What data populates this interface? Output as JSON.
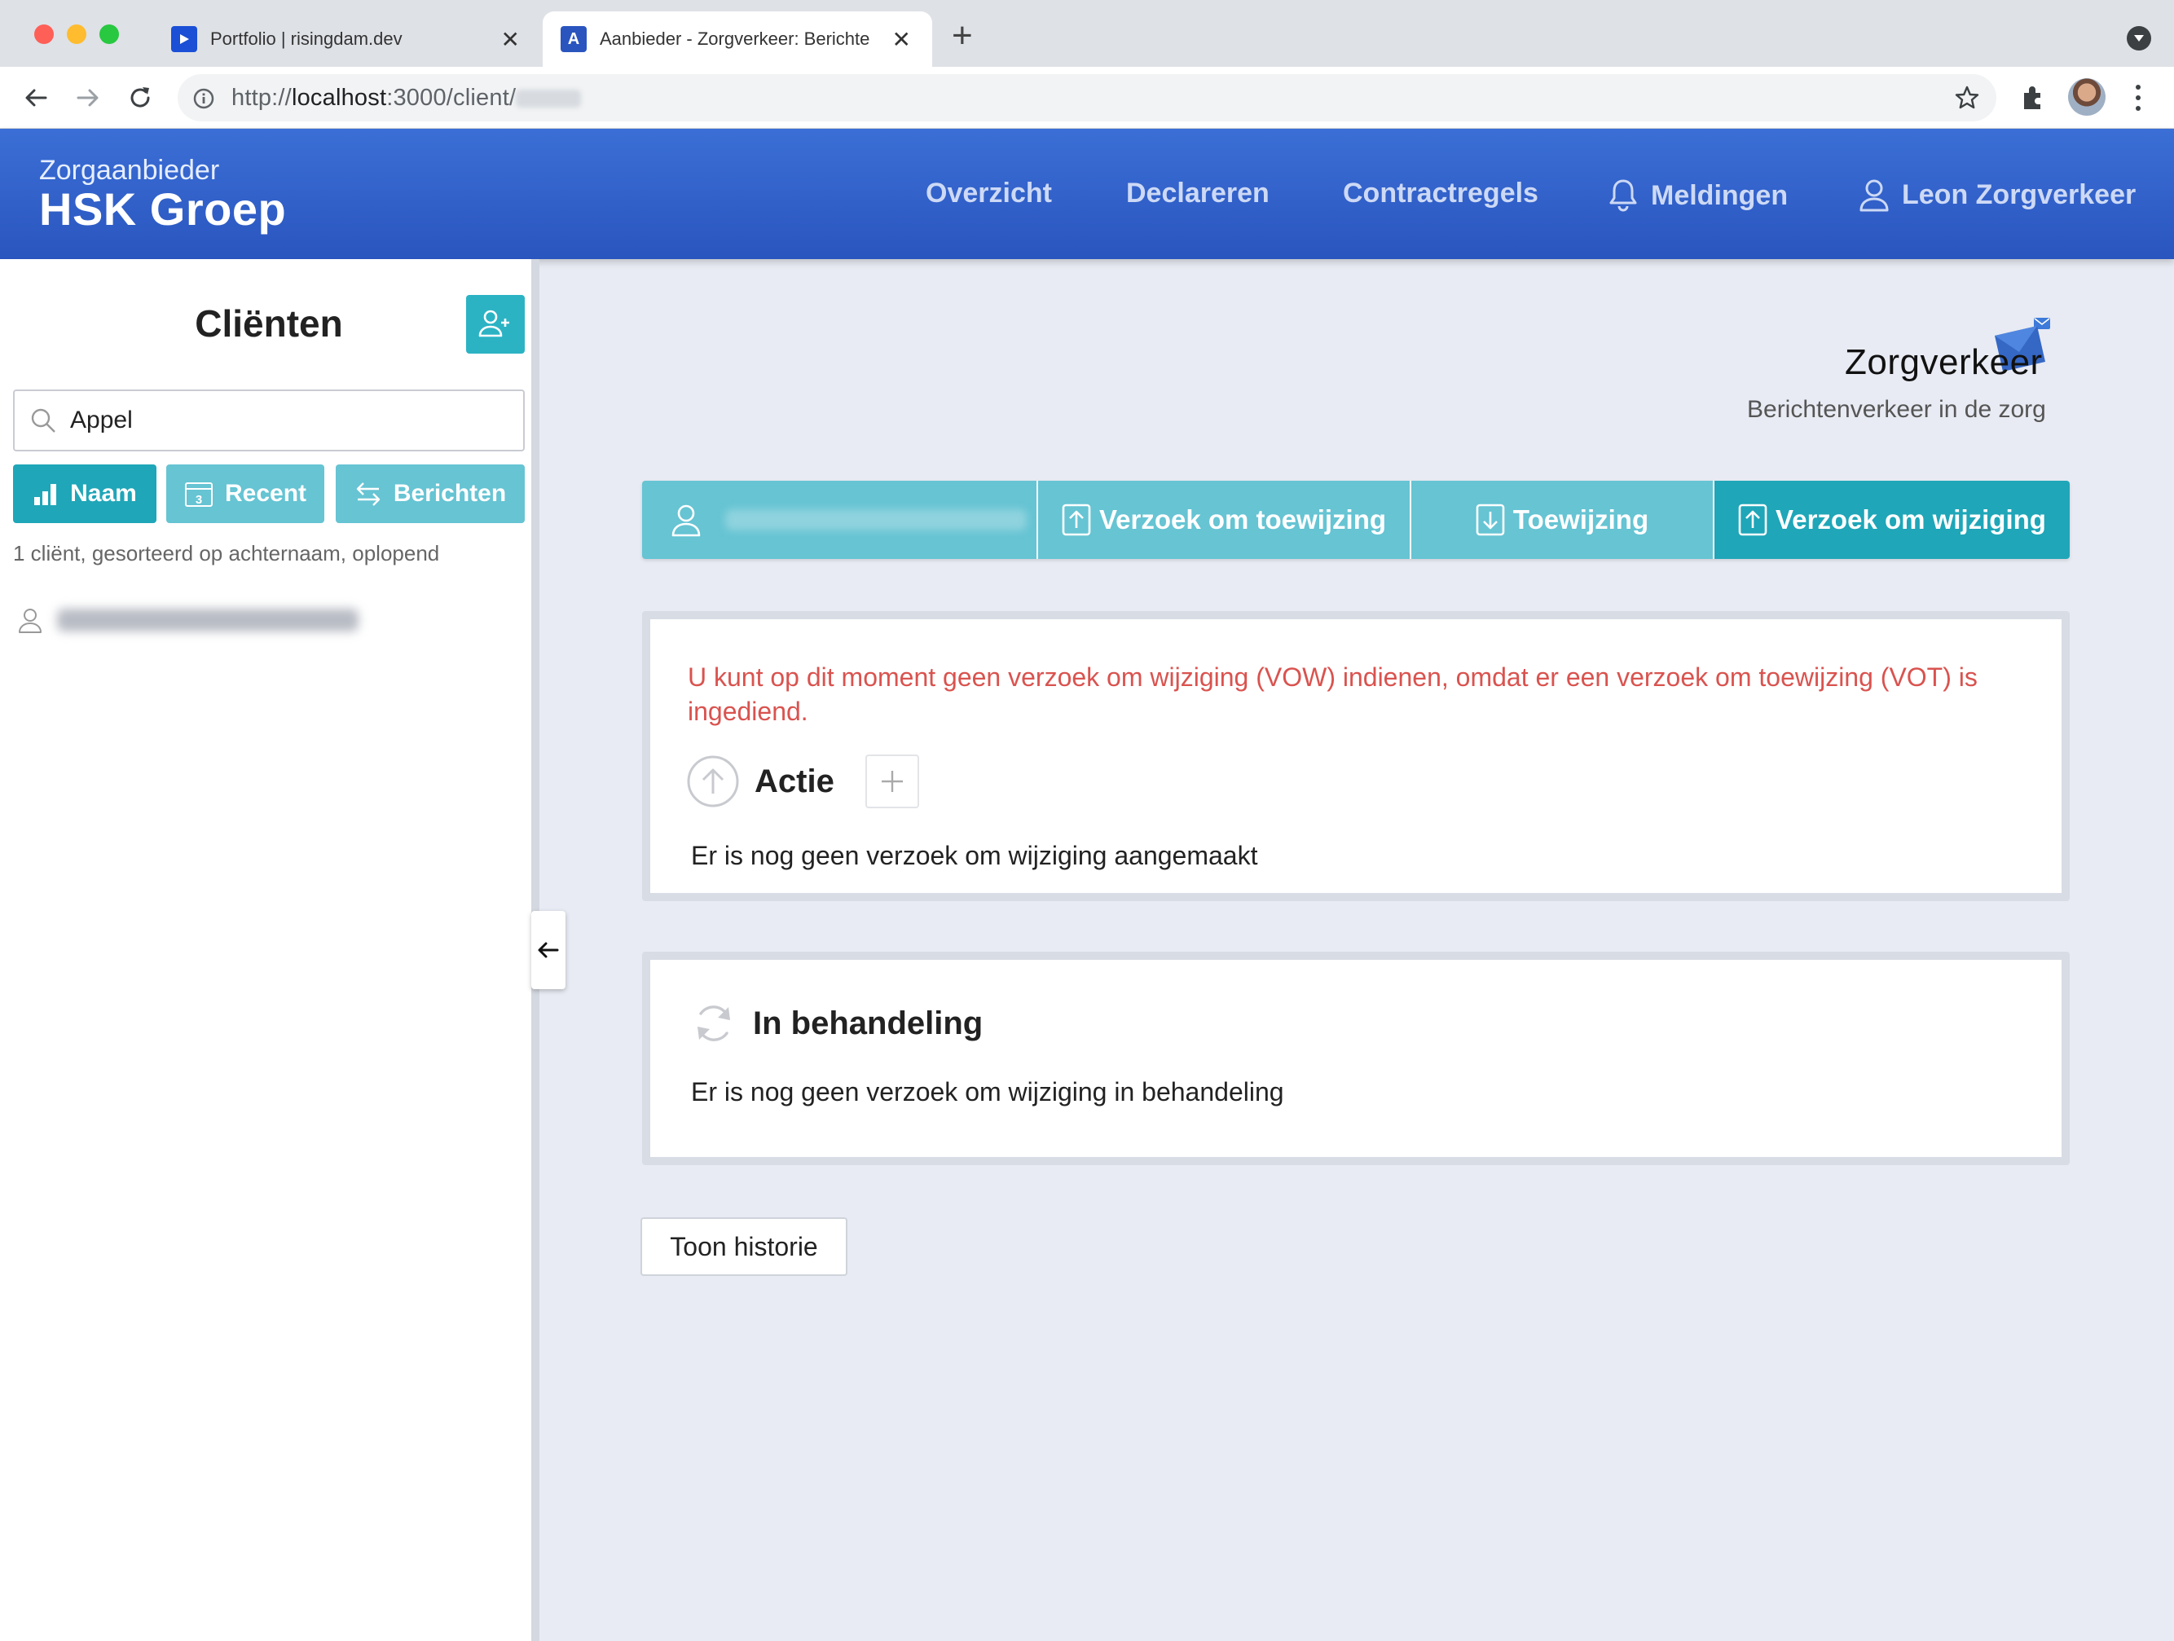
{
  "browser": {
    "tabs": [
      {
        "title": "Portfolio | risingdam.dev",
        "favicon": "play-icon",
        "active": false
      },
      {
        "title": "Aanbieder - Zorgverkeer: Berichte",
        "favicon": "A",
        "active": true
      }
    ],
    "url_prefix": "http://",
    "url_host": "localhost",
    "url_rest": ":3000/client/"
  },
  "header": {
    "brand_sub": "Zorgaanbieder",
    "brand_main": "HSK Groep",
    "menu": [
      "Overzicht",
      "Declareren",
      "Contractregels",
      "Meldingen",
      "Leon Zorgverkeer"
    ]
  },
  "sidebar": {
    "title": "Cliënten",
    "search_value": "Appel",
    "sort_buttons": [
      "Naam",
      "Recent",
      "Berichten"
    ],
    "sort_info": "1 cliënt, gesorteerd op achternaam, oplopend"
  },
  "logo": {
    "title": "Zorgverkeer",
    "subtitle": "Berichtenverkeer in de zorg"
  },
  "tabs": [
    "Verzoek om toewijzing",
    "Toewijzing",
    "Verzoek om wijziging"
  ],
  "action_card": {
    "warning": "U kunt op dit moment geen verzoek om wijziging (VOW) indienen, omdat er een verzoek om toewijzing (VOT) is ingediend.",
    "heading": "Actie",
    "text": "Er is nog geen verzoek om wijziging aangemaakt"
  },
  "processing_card": {
    "heading": "In behandeling",
    "text": "Er is nog geen verzoek om wijziging in behandeling"
  },
  "history_button": "Toon historie",
  "colors": {
    "header": "#2f5fcb",
    "accent": "#1fa6b8",
    "tab_light": "#66c4d3",
    "warning": "#d9534f"
  }
}
